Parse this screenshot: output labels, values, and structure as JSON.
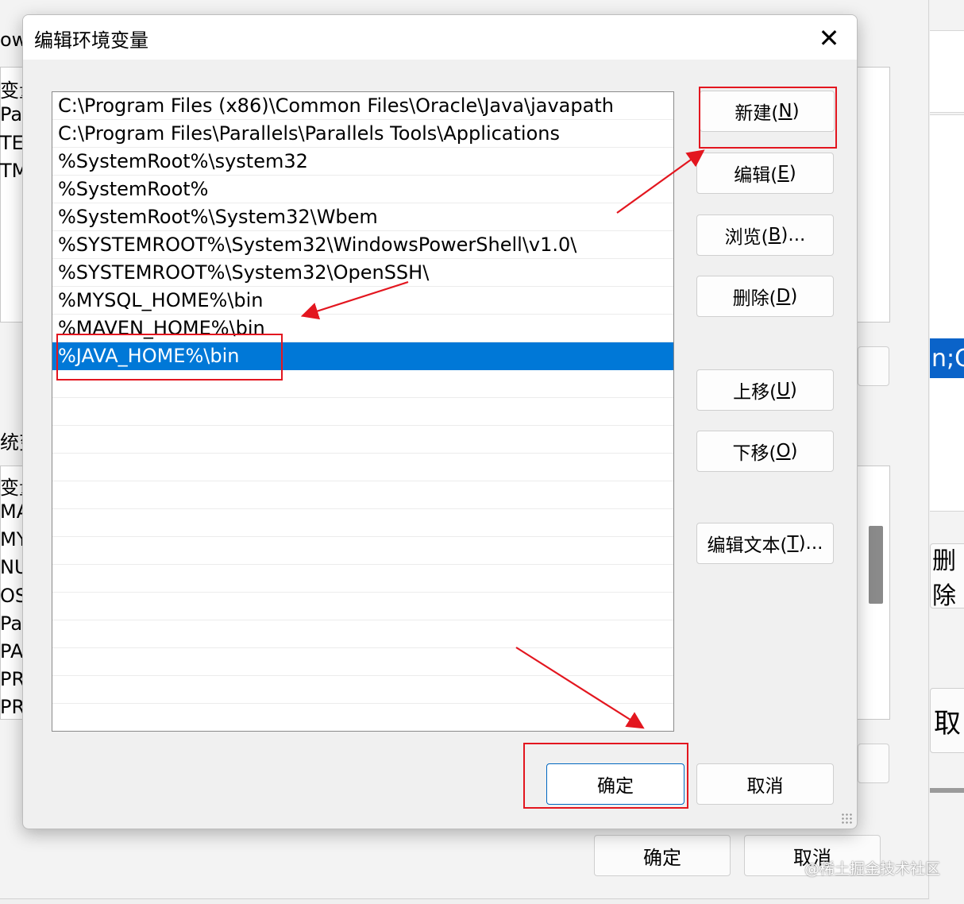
{
  "background": {
    "left_fragments": [
      "owa",
      "变量",
      "Pat",
      "TEM",
      "TMI",
      "统变",
      "变量",
      "MA",
      "MY",
      "NU",
      "OS",
      "Pat",
      "PA",
      "PR",
      "PR"
    ],
    "right_fragments": {
      "selected_text": "n;C",
      "delete_label": "删除",
      "cancel_label": "取"
    },
    "ok_label": "确定",
    "cancel_label": "取消"
  },
  "dialog": {
    "title": "编辑环境变量",
    "close_glyph": "✕",
    "paths": [
      "C:\\Program Files (x86)\\Common Files\\Oracle\\Java\\javapath",
      "C:\\Program Files\\Parallels\\Parallels Tools\\Applications",
      "%SystemRoot%\\system32",
      "%SystemRoot%",
      "%SystemRoot%\\System32\\Wbem",
      "%SYSTEMROOT%\\System32\\WindowsPowerShell\\v1.0\\",
      "%SYSTEMROOT%\\System32\\OpenSSH\\",
      "%MYSQL_HOME%\\bin",
      "%MAVEN_HOME%\\bin",
      "%JAVA_HOME%\\bin"
    ],
    "selected_index": 9,
    "buttons": {
      "new": {
        "text": "新建(",
        "key": "N",
        "tail": ")"
      },
      "edit": {
        "text": "编辑(",
        "key": "E",
        "tail": ")"
      },
      "browse": {
        "text": "浏览(",
        "key": "B",
        "tail": ")..."
      },
      "delete": {
        "text": "删除(",
        "key": "D",
        "tail": ")"
      },
      "move_up": {
        "text": "上移(",
        "key": "U",
        "tail": ")"
      },
      "move_down": {
        "text": "下移(",
        "key": "O",
        "tail": ")"
      },
      "edit_text": {
        "text": "编辑文本(",
        "key": "T",
        "tail": ")..."
      }
    },
    "ok_label": "确定",
    "cancel_label": "取消"
  },
  "annotation_color": "#e3161f",
  "selection_color": "#0078d7",
  "watermark": "@稀土掘金技术社区"
}
